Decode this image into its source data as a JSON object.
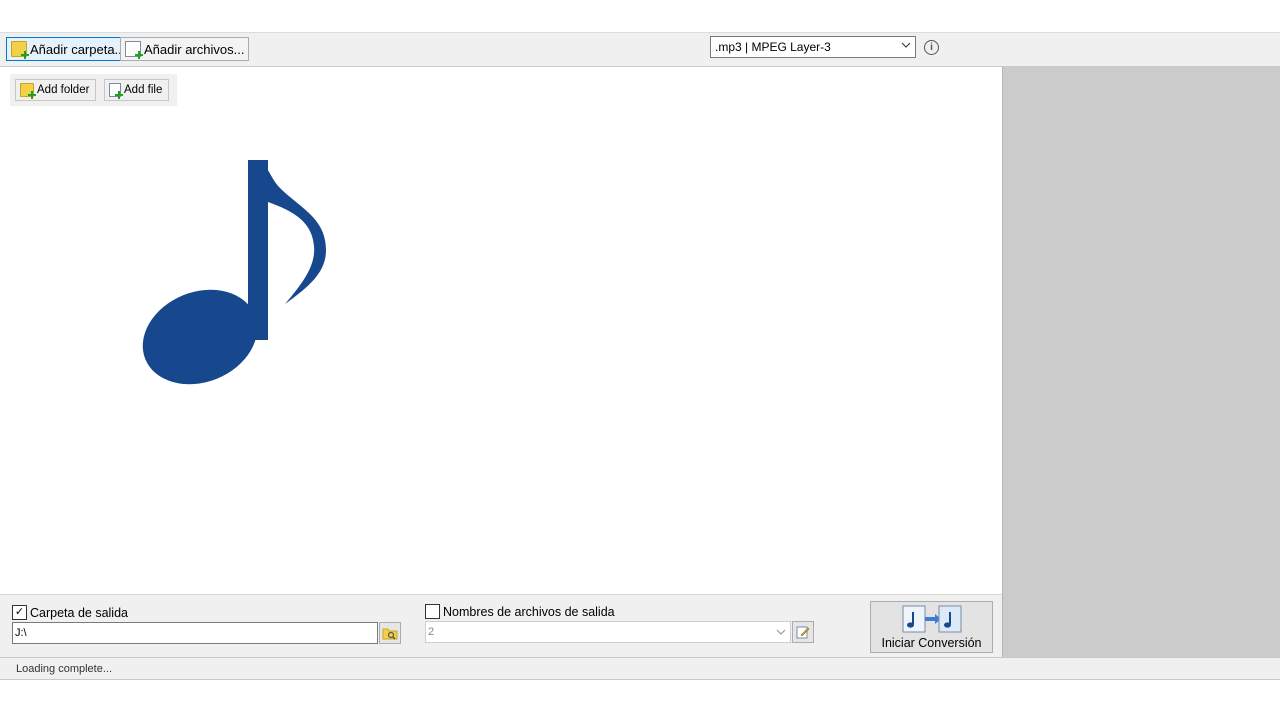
{
  "toolbar": {
    "add_folder_label": "Añadir carpeta...",
    "add_files_label": "Añadir archivos...",
    "format_select": {
      "selected": ".mp3 | MPEG Layer-3"
    },
    "info_glyph": "i"
  },
  "inner_toolbar": {
    "add_folder_label": "Add folder",
    "add_file_label": "Add file"
  },
  "main": {
    "placeholder_icon": "music-note-icon",
    "icon_color": "#17478c"
  },
  "output": {
    "folder_checkbox_checked": true,
    "folder_checkbox_glyph": "✓",
    "folder_label": "Carpeta de salida",
    "folder_path": "J:\\",
    "names_checkbox_checked": false,
    "names_label": "Nombres de archivos de salida",
    "names_value": "2"
  },
  "start_button": {
    "label": "Iniciar Conversión"
  },
  "status": {
    "text": "Loading complete..."
  },
  "colors": {
    "accent": "#0078d7",
    "panel_gray": "#cbcbcb",
    "toolbar_bg": "#f0f0f0"
  }
}
